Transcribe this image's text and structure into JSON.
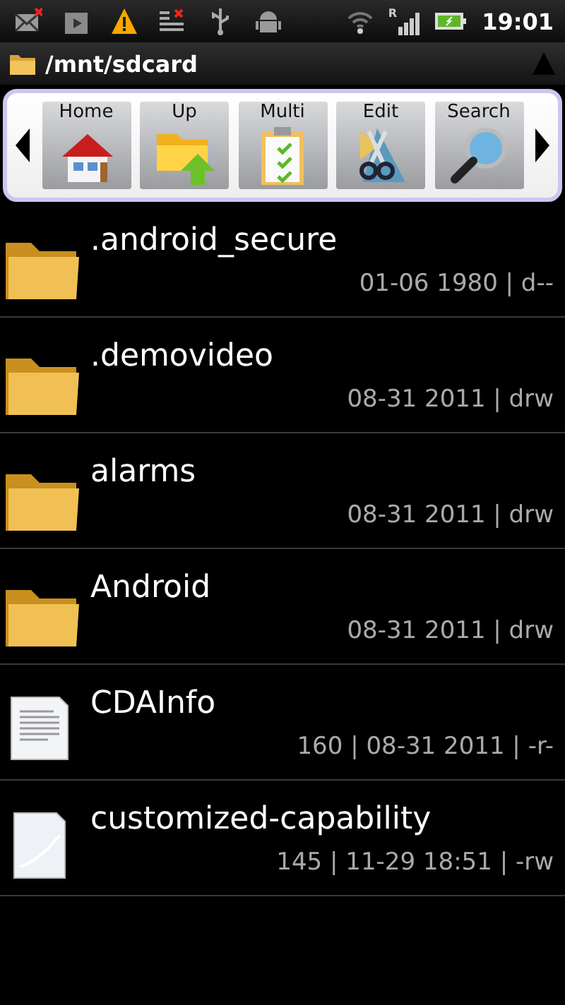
{
  "status_bar": {
    "icons": [
      {
        "kind": "mail-error"
      },
      {
        "kind": "store"
      },
      {
        "kind": "warning"
      },
      {
        "kind": "list-error"
      },
      {
        "kind": "usb"
      },
      {
        "kind": "android"
      }
    ],
    "roaming": "R",
    "time": "19:01"
  },
  "path_bar": {
    "path": "/mnt/sdcard"
  },
  "toolbar": {
    "buttons": [
      {
        "label": "Home",
        "kind": "home"
      },
      {
        "label": "Up",
        "kind": "up"
      },
      {
        "label": "Multi",
        "kind": "multi"
      },
      {
        "label": "Edit",
        "kind": "edit"
      },
      {
        "label": "Search",
        "kind": "search"
      }
    ]
  },
  "files": [
    {
      "name": ".android_secure",
      "kind": "folder",
      "details": "01-06  1980 | d--"
    },
    {
      "name": ".demovideo",
      "kind": "folder",
      "details": "08-31  2011 | drw"
    },
    {
      "name": "alarms",
      "kind": "folder",
      "details": "08-31  2011 | drw"
    },
    {
      "name": "Android",
      "kind": "folder",
      "details": "08-31  2011 | drw"
    },
    {
      "name": "CDAInfo",
      "kind": "document",
      "details": "160 | 08-31  2011 | -r-"
    },
    {
      "name": "customized-capability",
      "kind": "blank",
      "details": "145 | 11-29 18:51 | -rw"
    }
  ]
}
